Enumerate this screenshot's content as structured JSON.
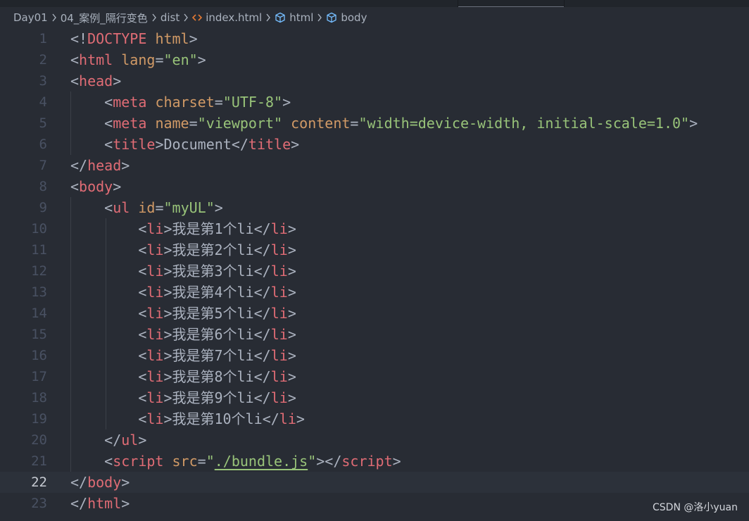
{
  "breadcrumb": {
    "items": [
      {
        "label": "Day01",
        "icon": "none"
      },
      {
        "label": "04_案例_隔行变色",
        "icon": "none"
      },
      {
        "label": "dist",
        "icon": "none"
      },
      {
        "label": "index.html",
        "icon": "html-file-icon"
      },
      {
        "label": "html",
        "icon": "element-cube-icon"
      },
      {
        "label": "body",
        "icon": "element-cube-icon"
      }
    ]
  },
  "editor": {
    "current_line": 22,
    "lines": [
      {
        "n": "1",
        "tokens": [
          [
            "p",
            "<!"
          ],
          [
            "t",
            "DOCTYPE"
          ],
          [
            "p",
            " "
          ],
          [
            "a",
            "html"
          ],
          [
            "p",
            ">"
          ]
        ]
      },
      {
        "n": "2",
        "tokens": [
          [
            "p",
            "<"
          ],
          [
            "t",
            "html"
          ],
          [
            "p",
            " "
          ],
          [
            "a",
            "lang"
          ],
          [
            "p",
            "="
          ],
          [
            "s",
            "\"en\""
          ],
          [
            "p",
            ">"
          ]
        ]
      },
      {
        "n": "3",
        "tokens": [
          [
            "p",
            "<"
          ],
          [
            "t",
            "head"
          ],
          [
            "p",
            ">"
          ]
        ]
      },
      {
        "n": "4",
        "tokens": [
          [
            "p",
            "    <"
          ],
          [
            "t",
            "meta"
          ],
          [
            "p",
            " "
          ],
          [
            "a",
            "charset"
          ],
          [
            "p",
            "="
          ],
          [
            "s",
            "\"UTF-8\""
          ],
          [
            "p",
            ">"
          ]
        ]
      },
      {
        "n": "5",
        "tokens": [
          [
            "p",
            "    <"
          ],
          [
            "t",
            "meta"
          ],
          [
            "p",
            " "
          ],
          [
            "a",
            "name"
          ],
          [
            "p",
            "="
          ],
          [
            "s",
            "\"viewport\""
          ],
          [
            "p",
            " "
          ],
          [
            "a",
            "content"
          ],
          [
            "p",
            "="
          ],
          [
            "s",
            "\"width=device-width, initial-scale=1.0\""
          ],
          [
            "p",
            ">"
          ]
        ]
      },
      {
        "n": "6",
        "tokens": [
          [
            "p",
            "    <"
          ],
          [
            "t",
            "title"
          ],
          [
            "p",
            ">"
          ],
          [
            "txt",
            "Document"
          ],
          [
            "p",
            "</"
          ],
          [
            "t",
            "title"
          ],
          [
            "p",
            ">"
          ]
        ]
      },
      {
        "n": "7",
        "tokens": [
          [
            "p",
            "</"
          ],
          [
            "t",
            "head"
          ],
          [
            "p",
            ">"
          ]
        ]
      },
      {
        "n": "8",
        "tokens": [
          [
            "p",
            "<"
          ],
          [
            "t",
            "body"
          ],
          [
            "p",
            ">"
          ]
        ]
      },
      {
        "n": "9",
        "tokens": [
          [
            "p",
            "    <"
          ],
          [
            "t",
            "ul"
          ],
          [
            "p",
            " "
          ],
          [
            "a",
            "id"
          ],
          [
            "p",
            "="
          ],
          [
            "s",
            "\"myUL\""
          ],
          [
            "p",
            ">"
          ]
        ]
      },
      {
        "n": "10",
        "tokens": [
          [
            "p",
            "        <"
          ],
          [
            "t",
            "li"
          ],
          [
            "p",
            ">"
          ],
          [
            "txt",
            "我是第1个li"
          ],
          [
            "p",
            "</"
          ],
          [
            "t",
            "li"
          ],
          [
            "p",
            ">"
          ]
        ]
      },
      {
        "n": "11",
        "tokens": [
          [
            "p",
            "        <"
          ],
          [
            "t",
            "li"
          ],
          [
            "p",
            ">"
          ],
          [
            "txt",
            "我是第2个li"
          ],
          [
            "p",
            "</"
          ],
          [
            "t",
            "li"
          ],
          [
            "p",
            ">"
          ]
        ]
      },
      {
        "n": "12",
        "tokens": [
          [
            "p",
            "        <"
          ],
          [
            "t",
            "li"
          ],
          [
            "p",
            ">"
          ],
          [
            "txt",
            "我是第3个li"
          ],
          [
            "p",
            "</"
          ],
          [
            "t",
            "li"
          ],
          [
            "p",
            ">"
          ]
        ]
      },
      {
        "n": "13",
        "tokens": [
          [
            "p",
            "        <"
          ],
          [
            "t",
            "li"
          ],
          [
            "p",
            ">"
          ],
          [
            "txt",
            "我是第4个li"
          ],
          [
            "p",
            "</"
          ],
          [
            "t",
            "li"
          ],
          [
            "p",
            ">"
          ]
        ]
      },
      {
        "n": "14",
        "tokens": [
          [
            "p",
            "        <"
          ],
          [
            "t",
            "li"
          ],
          [
            "p",
            ">"
          ],
          [
            "txt",
            "我是第5个li"
          ],
          [
            "p",
            "</"
          ],
          [
            "t",
            "li"
          ],
          [
            "p",
            ">"
          ]
        ]
      },
      {
        "n": "15",
        "tokens": [
          [
            "p",
            "        <"
          ],
          [
            "t",
            "li"
          ],
          [
            "p",
            ">"
          ],
          [
            "txt",
            "我是第6个li"
          ],
          [
            "p",
            "</"
          ],
          [
            "t",
            "li"
          ],
          [
            "p",
            ">"
          ]
        ]
      },
      {
        "n": "16",
        "tokens": [
          [
            "p",
            "        <"
          ],
          [
            "t",
            "li"
          ],
          [
            "p",
            ">"
          ],
          [
            "txt",
            "我是第7个li"
          ],
          [
            "p",
            "</"
          ],
          [
            "t",
            "li"
          ],
          [
            "p",
            ">"
          ]
        ]
      },
      {
        "n": "17",
        "tokens": [
          [
            "p",
            "        <"
          ],
          [
            "t",
            "li"
          ],
          [
            "p",
            ">"
          ],
          [
            "txt",
            "我是第8个li"
          ],
          [
            "p",
            "</"
          ],
          [
            "t",
            "li"
          ],
          [
            "p",
            ">"
          ]
        ]
      },
      {
        "n": "18",
        "tokens": [
          [
            "p",
            "        <"
          ],
          [
            "t",
            "li"
          ],
          [
            "p",
            ">"
          ],
          [
            "txt",
            "我是第9个li"
          ],
          [
            "p",
            "</"
          ],
          [
            "t",
            "li"
          ],
          [
            "p",
            ">"
          ]
        ]
      },
      {
        "n": "19",
        "tokens": [
          [
            "p",
            "        <"
          ],
          [
            "t",
            "li"
          ],
          [
            "p",
            ">"
          ],
          [
            "txt",
            "我是第10个li"
          ],
          [
            "p",
            "</"
          ],
          [
            "t",
            "li"
          ],
          [
            "p",
            ">"
          ]
        ]
      },
      {
        "n": "20",
        "tokens": [
          [
            "p",
            "    </"
          ],
          [
            "t",
            "ul"
          ],
          [
            "p",
            ">"
          ]
        ]
      },
      {
        "n": "21",
        "tokens": [
          [
            "p",
            "    <"
          ],
          [
            "t",
            "script"
          ],
          [
            "p",
            " "
          ],
          [
            "a",
            "src"
          ],
          [
            "p",
            "="
          ],
          [
            "s",
            "\""
          ],
          [
            "link",
            "./bundle.js"
          ],
          [
            "s",
            "\""
          ],
          [
            "p",
            "></"
          ],
          [
            "t",
            "script"
          ],
          [
            "p",
            ">"
          ]
        ]
      },
      {
        "n": "22",
        "tokens": [
          [
            "p",
            "</"
          ],
          [
            "t",
            "body"
          ],
          [
            "p",
            ">"
          ]
        ]
      },
      {
        "n": "23",
        "tokens": [
          [
            "p",
            "</"
          ],
          [
            "t",
            "html"
          ],
          [
            "p",
            ">"
          ]
        ]
      }
    ]
  },
  "watermark": {
    "text": "CSDN @洛小yuan"
  },
  "colors": {
    "background": "#282c34",
    "tag": "#e06c75",
    "attribute": "#d19a66",
    "string": "#98c379",
    "punctuation": "#abb2bf",
    "line_number": "#495162"
  }
}
